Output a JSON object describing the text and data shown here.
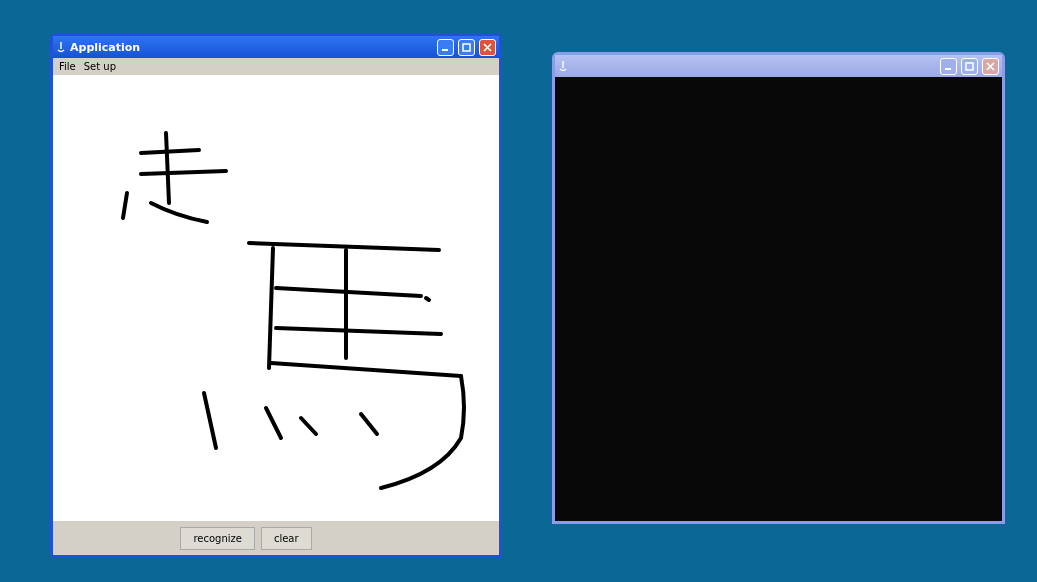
{
  "windows": [
    {
      "kind": "canvas",
      "title": "Application",
      "active": true,
      "menu": [
        "File",
        "Set up"
      ],
      "buttons": [
        "recognize",
        "clear"
      ]
    },
    {
      "kind": "display",
      "active": false
    }
  ]
}
